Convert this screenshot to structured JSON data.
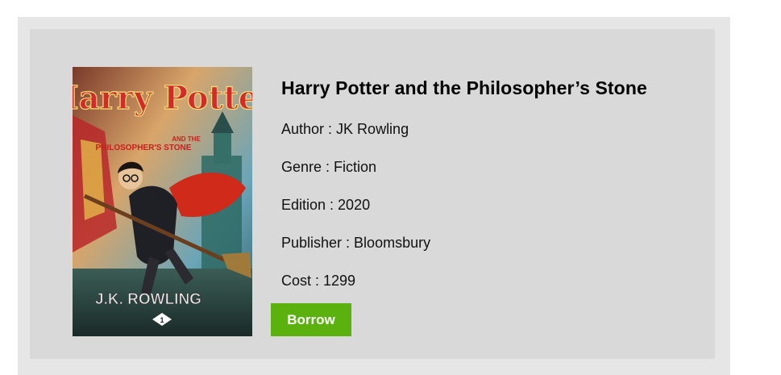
{
  "book": {
    "title": "Harry Potter and the Philosopher’s Stone",
    "author_label": "Author : ",
    "author": "JK Rowling",
    "genre_label": "Genre : ",
    "genre": "Fiction",
    "edition_label": "Edition : ",
    "edition": "2020",
    "publisher_label": "Publisher : ",
    "publisher": "Bloomsbury",
    "cost_label": "Cost : ",
    "cost": "1299"
  },
  "cover": {
    "title_line1": "Harry Potter",
    "subtitle_line1": "AND THE",
    "subtitle_line2": "PHILOSOPHER'S STONE",
    "author": "J.K. ROWLING",
    "volume": "1"
  },
  "actions": {
    "borrow_label": "Borrow"
  },
  "colors": {
    "card_bg": "#d9d9d9",
    "outer_bg": "#e6e6e6",
    "borrow_bg": "#5bb20f"
  }
}
